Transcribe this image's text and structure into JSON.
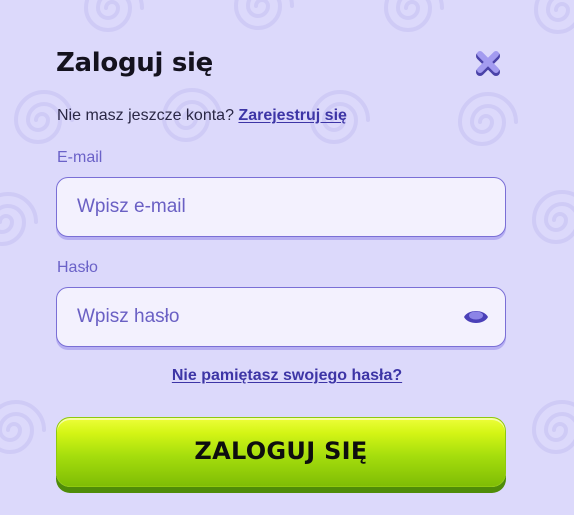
{
  "login": {
    "title": "Zaloguj się",
    "register_prompt": "Nie masz jeszcze konta?",
    "register_link": "Zarejestruj się",
    "email": {
      "label": "E-mail",
      "placeholder": "Wpisz e-mail",
      "value": ""
    },
    "password": {
      "label": "Hasło",
      "placeholder": "Wpisz hasło",
      "value": ""
    },
    "forgot_link": "Nie pamiętasz swojego hasła?",
    "submit_label": "ZALOGUJ SIĘ"
  },
  "icons": {
    "close": "close-icon",
    "password_visibility": "eye-icon"
  },
  "colors": {
    "background": "#dcd9fb",
    "accent": "#3d35a6",
    "input_border": "#7a6fd6",
    "button_green": "#a6de0d"
  }
}
